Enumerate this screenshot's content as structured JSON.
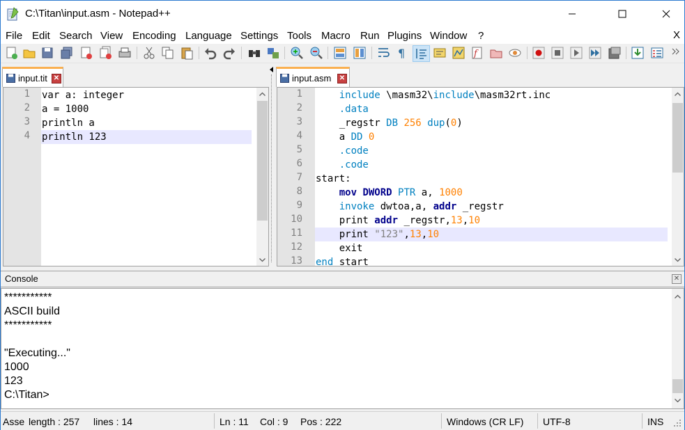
{
  "window": {
    "title": "C:\\Titan\\input.asm - Notepad++"
  },
  "menu": [
    "File",
    "Edit",
    "Search",
    "View",
    "Encoding",
    "Language",
    "Settings",
    "Tools",
    "Macro",
    "Run",
    "Plugins",
    "Window",
    "?"
  ],
  "menu_close": "X",
  "left_tab": {
    "label": "input.tit"
  },
  "right_tab": {
    "label": "input.asm"
  },
  "left_editor": {
    "line_numbers": [
      "1",
      "2",
      "3",
      "4"
    ],
    "lines": [
      "var a: integer",
      "a = 1000",
      "println a",
      "println 123"
    ],
    "current_line": 4
  },
  "right_editor": {
    "line_numbers": [
      "1",
      "2",
      "3",
      "4",
      "5",
      "6",
      "7",
      "8",
      "9",
      "10",
      "11",
      "12",
      "13"
    ],
    "current_line": 11
  },
  "console": {
    "title": "Console",
    "lines": [
      "***********",
      "ASCII build",
      "***********",
      "",
      "\"Executing...\"",
      "1000",
      "123",
      "C:\\Titan>"
    ]
  },
  "status": {
    "lang": "Asser",
    "length": "length : 257",
    "lines": "lines : 14",
    "ln": "Ln : 11",
    "col": "Col : 9",
    "pos": "Pos : 222",
    "eol": "Windows (CR LF)",
    "encoding": "UTF-8",
    "mode": "INS"
  },
  "colors": {
    "keyword": "#0080c0",
    "instruction": "#00008b",
    "number": "#ff8000",
    "current_line": "#e8e8ff",
    "tab_accent": "#fab050"
  }
}
